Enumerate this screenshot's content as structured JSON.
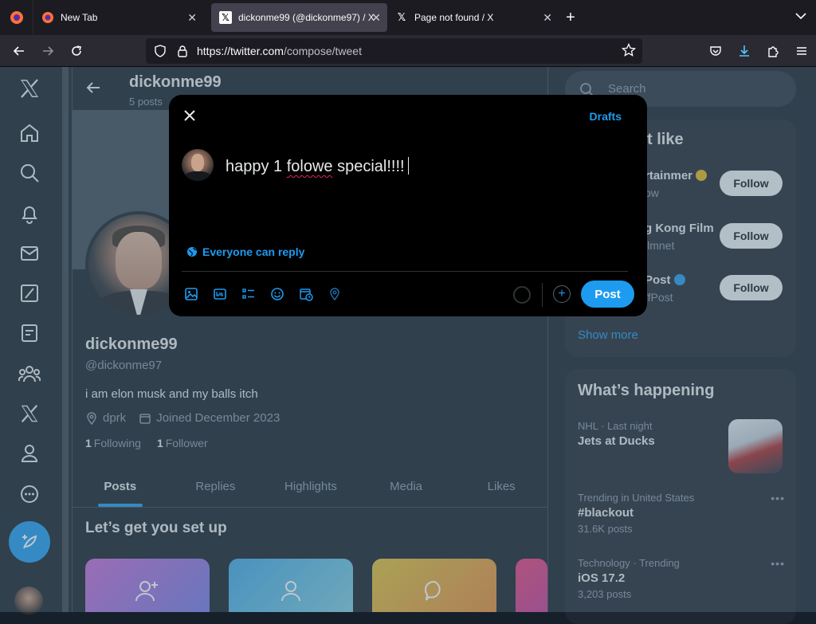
{
  "browser": {
    "tabs": [
      {
        "label": "New Tab",
        "active": false
      },
      {
        "label": "dickonme99 (@dickonme97) / X",
        "active": true
      },
      {
        "label": "Page not found / X",
        "active": false
      }
    ],
    "url_host": "https://twitter.com",
    "url_path": "/compose/tweet"
  },
  "profile": {
    "header_name": "dickonme99",
    "header_posts": "5 posts",
    "name": "dickonme99",
    "handle": "@dickonme97",
    "bio": "i am elon musk and my balls itch",
    "location": "dprk",
    "joined": "Joined December 2023",
    "following_count": "1",
    "following_label": "Following",
    "followers_count": "1",
    "followers_label": "Follower",
    "tabs": [
      "Posts",
      "Replies",
      "Highlights",
      "Media",
      "Likes"
    ],
    "setup_title": "Let’s get you set up"
  },
  "search": {
    "placeholder": "Search"
  },
  "who_to_follow": {
    "title_visible": "t like",
    "accounts": [
      {
        "name": "rtainmer",
        "handle": "ow",
        "verified_color": "#e2b719"
      },
      {
        "name": "g Kong Film",
        "handle": "ilmnet",
        "verified_color": ""
      },
      {
        "name": "Post",
        "handle": "ffPost",
        "verified_color": "#1d9bf0"
      }
    ],
    "follow_label": "Follow",
    "show_more": "Show more"
  },
  "happening": {
    "title": "What’s happening",
    "trends": [
      {
        "context": "NHL · Last night",
        "title": "Jets at Ducks",
        "count": ""
      },
      {
        "context": "Trending in United States",
        "title": "#blackout",
        "count": "31.6K posts"
      },
      {
        "context": "Technology · Trending",
        "title": "iOS 17.2",
        "count": "3,203 posts"
      }
    ]
  },
  "composer": {
    "drafts_label": "Drafts",
    "text_before": "happy 1 ",
    "text_misspelled": "folowe",
    "text_after": " special!!!!",
    "reply_setting": "Everyone can reply",
    "post_label": "Post"
  },
  "colors": {
    "accent": "#1d9bf0",
    "background": "#15202b",
    "card": "#1e2732",
    "modal": "#000000"
  }
}
